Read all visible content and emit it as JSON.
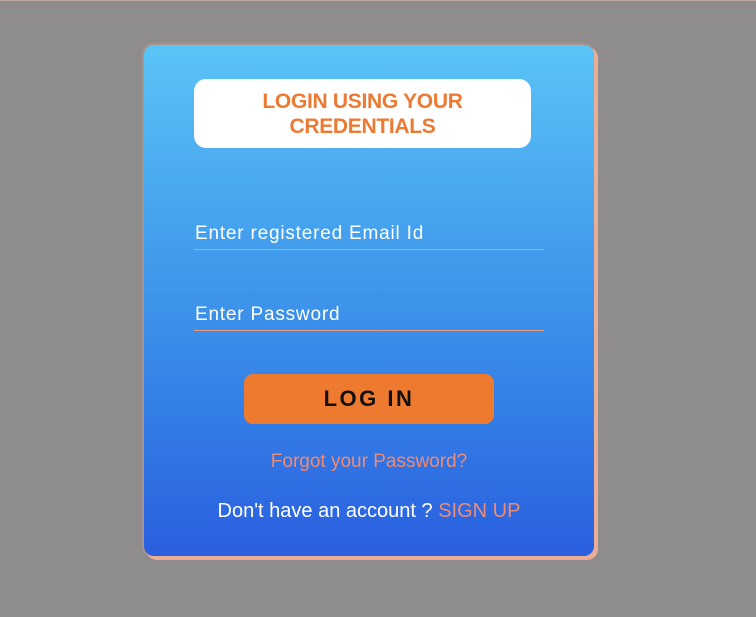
{
  "login_card": {
    "title": "LOGIN USING YOUR CREDENTIALS",
    "email_placeholder": "Enter registered Email Id",
    "email_value": "",
    "password_placeholder": "Enter Password",
    "password_value": "",
    "login_button_label": "LOG IN",
    "forgot_password_link": "Forgot your Password?",
    "signup_prompt": "Don't have an account ?",
    "signup_link": "SIGN UP"
  },
  "colors": {
    "page_background": "#8e8c8c",
    "card_gradient_top": "#5ac4f6",
    "card_gradient_bottom": "#2a5fe0",
    "accent_orange": "#ee7a30",
    "link_salmon": "#f08a70"
  }
}
